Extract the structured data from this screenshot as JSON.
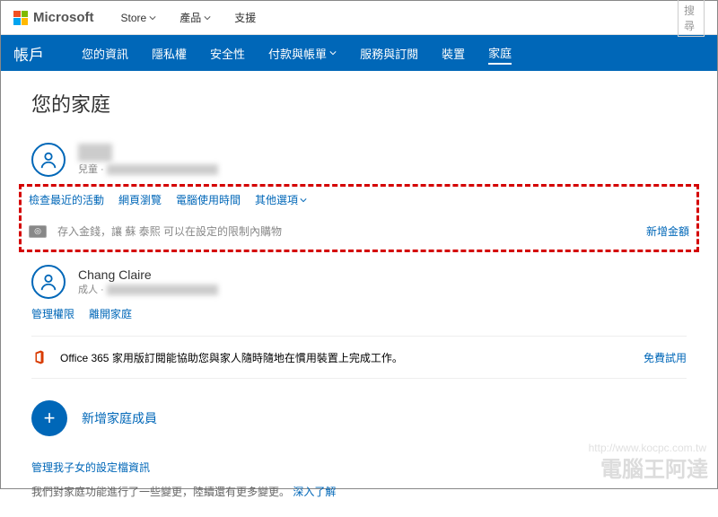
{
  "topbar": {
    "brand": "Microsoft",
    "store": "Store",
    "products": "產品",
    "support": "支援",
    "search_placeholder": "搜尋"
  },
  "bluebar": {
    "title": "帳戶",
    "items": [
      "您的資訊",
      "隱私權",
      "安全性",
      "付款與帳單",
      "服務與訂閱",
      "裝置",
      "家庭"
    ]
  },
  "page_title": "您的家庭",
  "child": {
    "name_hidden": "蘇 ██",
    "role": "兒童",
    "email_hidden": "████████████████",
    "actions": [
      "檢查最近的活動",
      "網頁瀏覽",
      "電腦使用時間",
      "其他選項"
    ],
    "money_text": "存入金錢，讓 蘇 泰熙 可以在設定的限制內購物",
    "add_money": "新增金額"
  },
  "adult": {
    "name": "Chang Claire",
    "role": "成人",
    "email_hidden": "████████████████",
    "actions": [
      "管理權限",
      "離開家庭"
    ]
  },
  "o365": {
    "text": "Office 365 家用版訂閱能協助您與家人隨時隨地在慣用裝置上完成工作。",
    "try": "免費試用"
  },
  "add_member": "新增家庭成員",
  "settings_link": "管理我子女的設定檔資訊",
  "footnote_pre": "我們對家庭功能進行了一些變更，陸續還有更多變更。",
  "footnote_link": "深入了解",
  "watermark": "電腦王阿達",
  "watermark_url": "http://www.kocpc.com.tw"
}
